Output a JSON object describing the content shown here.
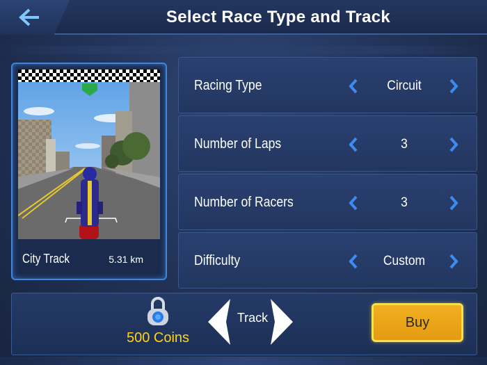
{
  "header": {
    "title": "Select Race Type and Track",
    "back_icon": "double-chevron-left-icon"
  },
  "track": {
    "name": "City Track",
    "length": "5.31 km"
  },
  "options": [
    {
      "label": "Racing Type",
      "value": "Circuit"
    },
    {
      "label": "Number of Laps",
      "value": "3"
    },
    {
      "label": "Number of Racers",
      "value": "3"
    },
    {
      "label": "Difficulty",
      "value": "Custom"
    }
  ],
  "bottom": {
    "coins": "500 Coins",
    "track_label": "Track",
    "buy_label": "Buy"
  },
  "colors": {
    "accent_blue": "#3f86d8",
    "coins_yellow": "#ffd21a",
    "buy_orange": "#e8a018"
  }
}
